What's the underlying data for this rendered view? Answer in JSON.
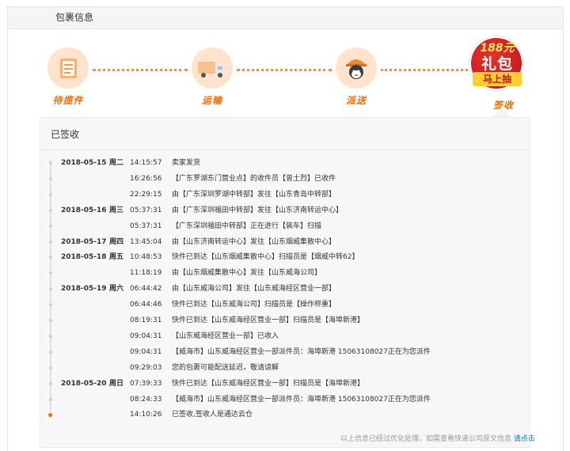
{
  "panel": {
    "title": "包裹信息"
  },
  "steps": [
    {
      "label": "待揽件",
      "icon": "package-list-icon"
    },
    {
      "label": "运输",
      "icon": "delivery-truck-icon"
    },
    {
      "label": "派送",
      "icon": "courier-icon"
    },
    {
      "label": "签收",
      "icon": "gift-icon"
    }
  ],
  "gift": {
    "amount": "188元",
    "title": "礼包",
    "ribbon": "马上抽"
  },
  "tracking": {
    "title": "已签收",
    "rows": [
      {
        "date": "2018-05-15",
        "week": "周二",
        "time": "14:15:57",
        "desc": "卖家发货"
      },
      {
        "date": "",
        "week": "",
        "time": "16:26:56",
        "desc": "【广东罗湖东门营业点】的收件员【曾土烈】已收件"
      },
      {
        "date": "",
        "week": "",
        "time": "22:29:15",
        "desc": "由【广东深圳罗湖中转部】发往【山东青岛中转部】"
      },
      {
        "date": "2018-05-16",
        "week": "周三",
        "time": "05:37:31",
        "desc": "由【广东深圳福田中转部】发往【山东济南转运中心】"
      },
      {
        "date": "",
        "week": "",
        "time": "05:37:31",
        "desc": "【广东深圳福田中转部】正在进行【装车】扫描"
      },
      {
        "date": "2018-05-17",
        "week": "周四",
        "time": "13:45:04",
        "desc": "由【山东济南转运中心】发往【山东烟威集散中心】"
      },
      {
        "date": "2018-05-18",
        "week": "周五",
        "time": "10:48:53",
        "desc": "快件已到达【山东烟威集散中心】扫描员是【烟威中转62】"
      },
      {
        "date": "",
        "week": "",
        "time": "11:18:19",
        "desc": "由【山东烟威集散中心】发往【山东威海公司】"
      },
      {
        "date": "2018-05-19",
        "week": "周六",
        "time": "06:44:42",
        "desc": "由【山东威海公司】发往【山东威海经区营业一部】"
      },
      {
        "date": "",
        "week": "",
        "time": "06:44:46",
        "desc": "快件已到达【山东威海公司】扫描员是【操作称重】"
      },
      {
        "date": "",
        "week": "",
        "time": "08:19:31",
        "desc": "快件已到达【山东威海经区营业一部】扫描员是【海埠新港】"
      },
      {
        "date": "",
        "week": "",
        "time": "09:04:31",
        "desc": "【山东威海经区营业一部】已收入"
      },
      {
        "date": "",
        "week": "",
        "time": "09:04:31",
        "desc": "【威海市】山东威海经区营业一部派件员：海埠新港 15063108027正在为您派件"
      },
      {
        "date": "",
        "week": "",
        "time": "09:29:03",
        "desc": "您的包裹可能配送延迟，敬请谅解"
      },
      {
        "date": "2018-05-20",
        "week": "周日",
        "time": "07:39:33",
        "desc": "快件已到达【山东威海经区营业一部】扫描员是【海埠新港】"
      },
      {
        "date": "",
        "week": "",
        "time": "08:24:33",
        "desc": "【威海市】山东威海经区营业一部派件员：海埠新港 15063108027正在为您派件"
      },
      {
        "date": "",
        "week": "",
        "time": "14:10:26",
        "desc": "已签收,签收人是通达云仓"
      }
    ]
  },
  "footer": {
    "note": "以上信息已经过优化处理，如需查看快递公司原文信息",
    "link": "请点击"
  },
  "colors": {
    "accent": "#ff6a00",
    "link": "#1a6fc0",
    "gift_red": "#d42026"
  }
}
